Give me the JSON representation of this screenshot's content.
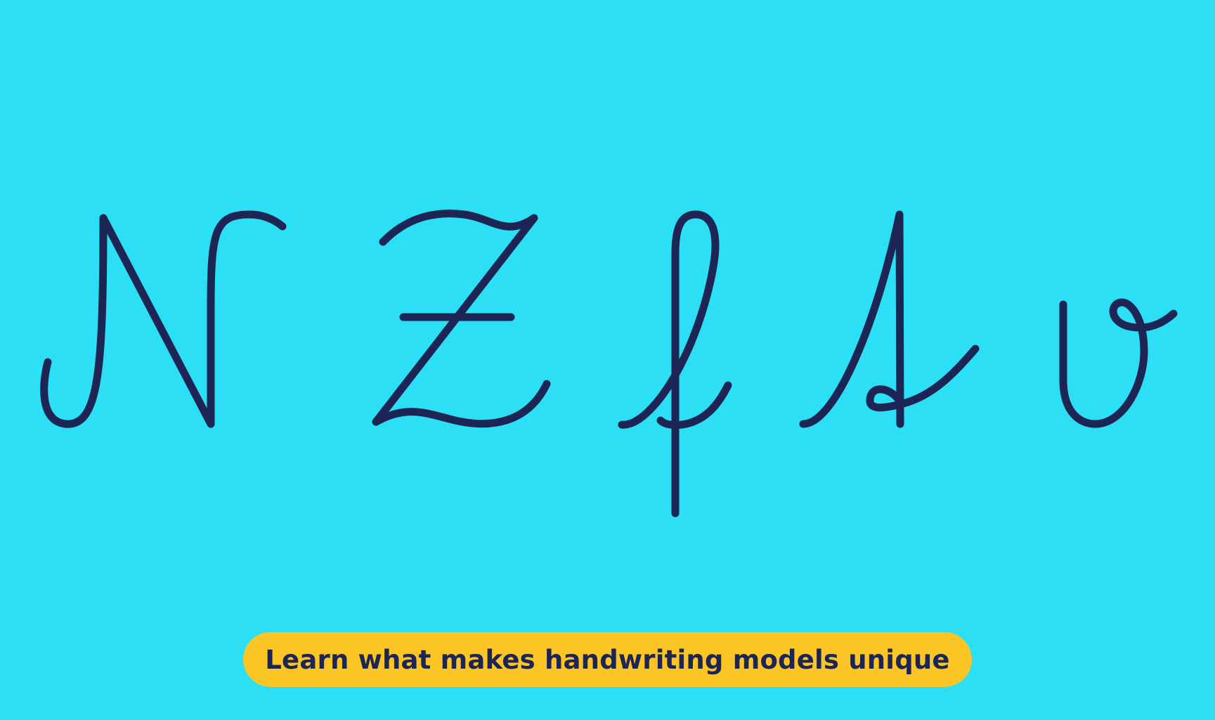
{
  "colors": {
    "background": "#2DDFF4",
    "ink": "#1C2554",
    "pill": "#FCC526"
  },
  "glyphs": [
    {
      "name": "cursive-capital-n-glyph"
    },
    {
      "name": "cursive-capital-z-glyph"
    },
    {
      "name": "cursive-lowercase-f-glyph"
    },
    {
      "name": "cursive-lowercase-s-glyph"
    },
    {
      "name": "cursive-lowercase-v-glyph"
    }
  ],
  "tagline": {
    "text": "Learn what makes handwriting models unique"
  }
}
